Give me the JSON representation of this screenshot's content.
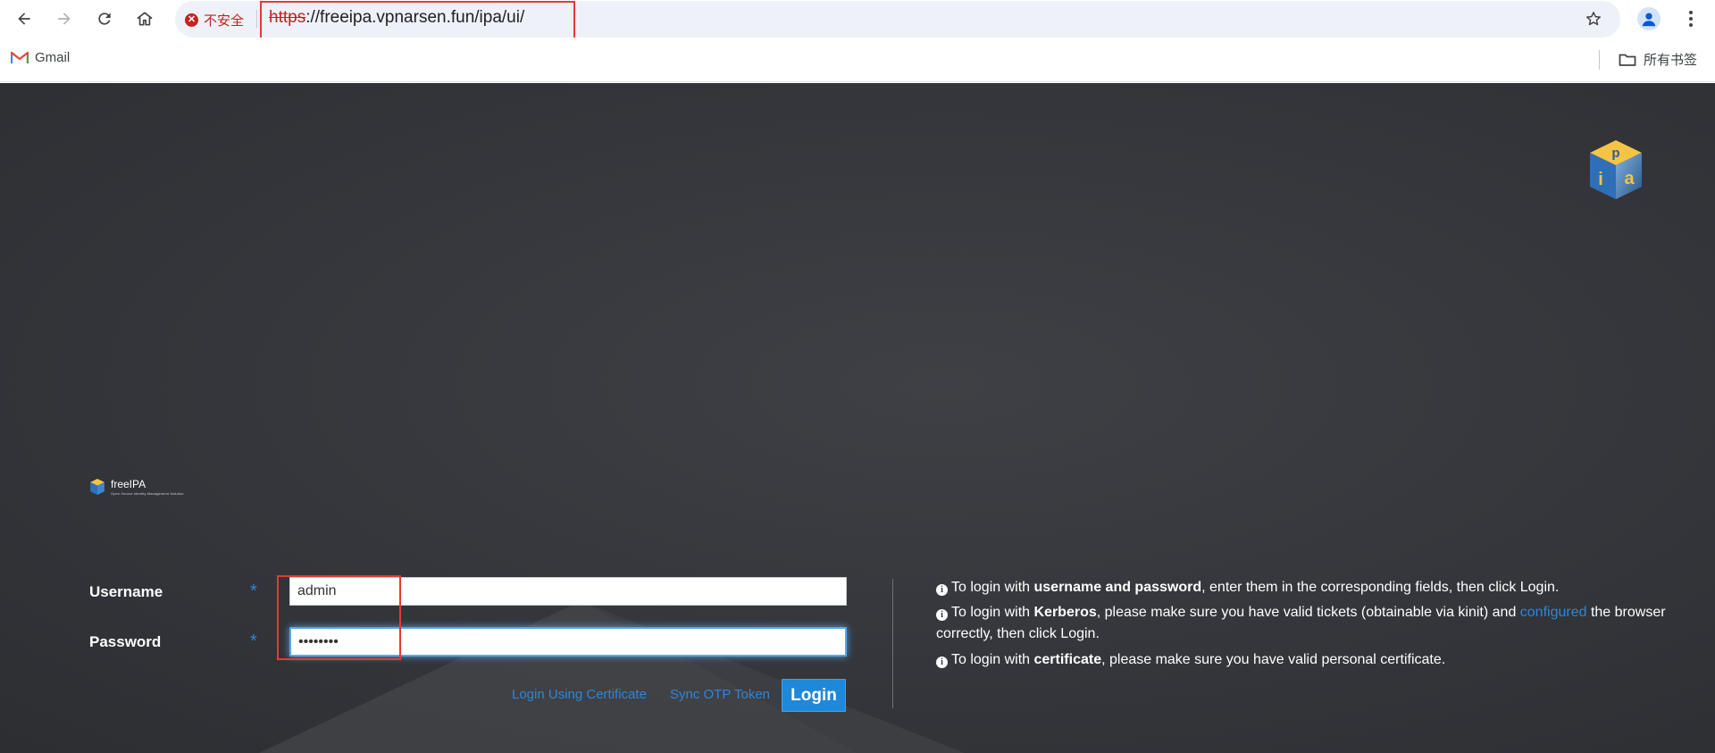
{
  "browser": {
    "security_chip": "不安全",
    "url_scheme": "https",
    "url_rest": "://freeipa.vpnarsen.fun/ipa/ui/",
    "bookmarks": {
      "gmail": "Gmail",
      "all_bookmarks": "所有书签"
    }
  },
  "brand": {
    "name": "freeIPA",
    "tagline": "Open Source Identity Management Solution"
  },
  "login_form": {
    "username_label": "Username",
    "password_label": "Password",
    "required_marker": "*",
    "username_value": "admin",
    "password_value": "********",
    "login_cert_link": "Login Using Certificate",
    "sync_otp_link": "Sync OTP Token",
    "login_button": "Login"
  },
  "info": {
    "icon": "i",
    "line1": {
      "pre": "To login with ",
      "bold": "username and password",
      "post": ", enter them in the corresponding fields, then click Login."
    },
    "line2": {
      "pre": "To login with ",
      "bold": "Kerberos",
      "mid": ", please make sure you have valid tickets (obtainable via kinit) and ",
      "link": "configured",
      "post": " the browser correctly, then click Login."
    },
    "line3": {
      "pre": "To login with ",
      "bold": "certificate",
      "post": ", please make sure you have valid personal certificate."
    }
  },
  "colors": {
    "page_bg": "#34363b",
    "accent": "#2f86d6",
    "insecure": "#c5221f",
    "highlight_box": "#e53935"
  }
}
